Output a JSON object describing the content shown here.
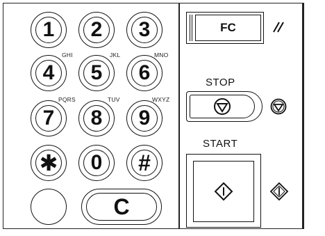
{
  "keypad": {
    "keys": [
      {
        "label": "1",
        "sub": ""
      },
      {
        "label": "2",
        "sub": ""
      },
      {
        "label": "3",
        "sub": ""
      },
      {
        "label": "4",
        "sub": "GHI"
      },
      {
        "label": "5",
        "sub": "JKL"
      },
      {
        "label": "6",
        "sub": "MNO"
      },
      {
        "label": "7",
        "sub": "PQRS"
      },
      {
        "label": "8",
        "sub": "TUV"
      },
      {
        "label": "9",
        "sub": "WXYZ"
      },
      {
        "label": "✱",
        "sub": ""
      },
      {
        "label": "0",
        "sub": ""
      },
      {
        "label": "#",
        "sub": ""
      }
    ],
    "clear_label": "C"
  },
  "controls": {
    "fc_label": "FC",
    "stop_label": "STOP",
    "start_label": "START"
  }
}
